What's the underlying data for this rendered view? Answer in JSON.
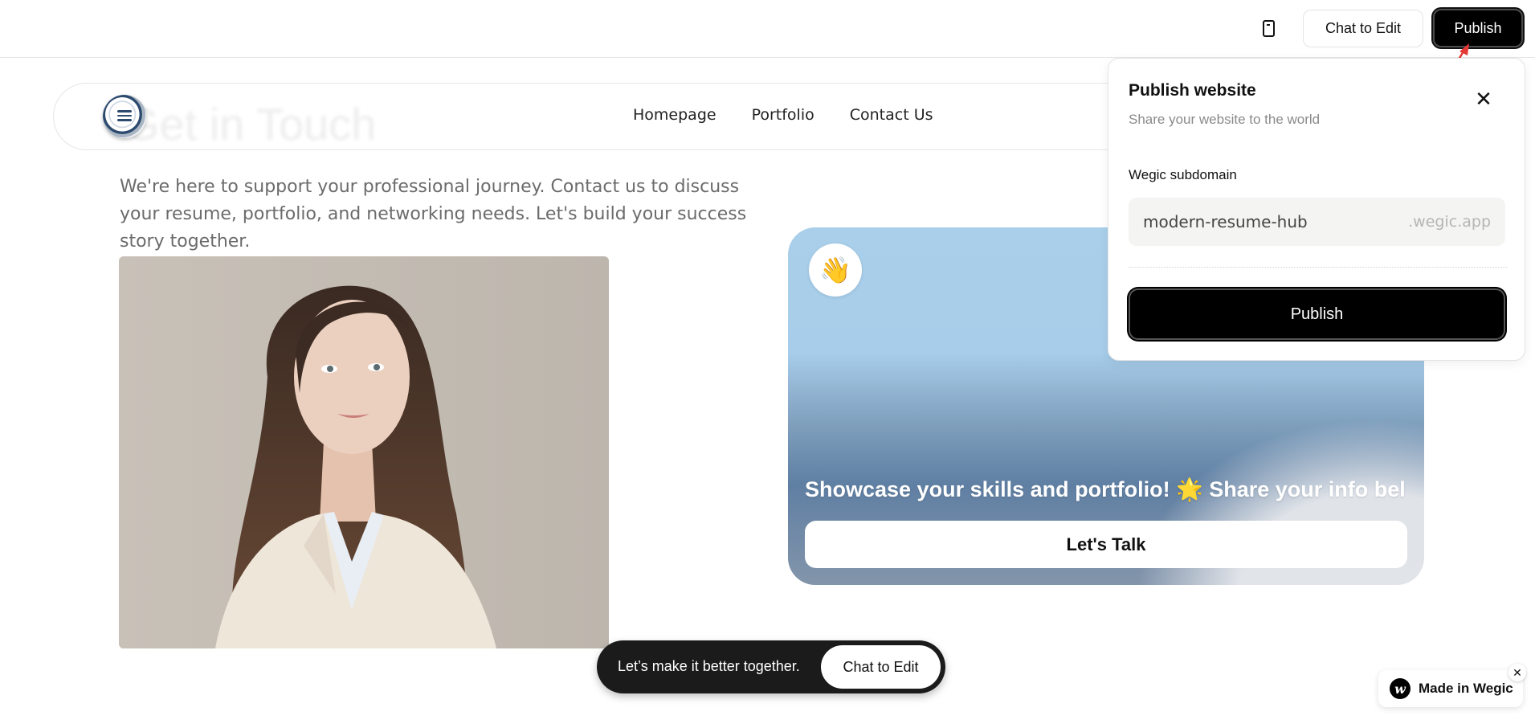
{
  "toolbar": {
    "device_icon": "mobile-device-icon",
    "chat_label": "Chat to Edit",
    "publish_label": "Publish"
  },
  "site": {
    "ghost_title": "Get in Touch",
    "nav": [
      "Homepage",
      "Portfolio",
      "Contact Us"
    ],
    "intro": "We're here to support your professional journey. Contact us to discuss your resume, portfolio, and networking needs. Let's build your success story together.",
    "card": {
      "emoji": "👋",
      "headline": "Showcase your skills and portfolio! 🌟 Share your info bel",
      "cta": "Let's Talk"
    }
  },
  "publish_popover": {
    "title": "Publish website",
    "subtitle": "Share your website to the world",
    "field_label": "Wegic subdomain",
    "subdomain_value": "modern-resume-hub",
    "suffix": ".wegic.app",
    "publish_label": "Publish"
  },
  "bottom_bar": {
    "message": "Let’s make it better together.",
    "chat_label": "Chat to Edit"
  },
  "badge": {
    "text": "Made in Wegic",
    "logo_letter": "w"
  },
  "colors": {
    "primary": "#000000",
    "annotation_arrow": "#e53935"
  }
}
